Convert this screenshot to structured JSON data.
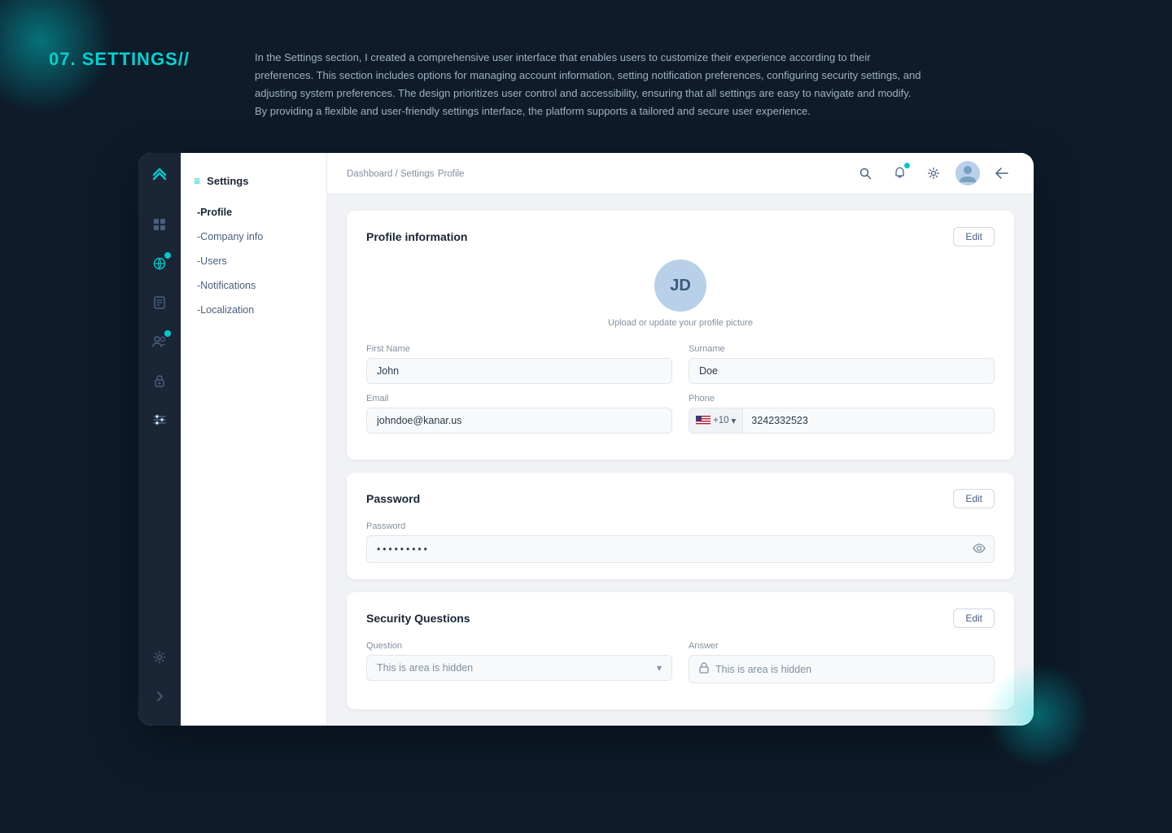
{
  "page": {
    "section_number": "07.",
    "section_title": "SETTINGS//",
    "description": "In the Settings section, I created a comprehensive user interface that enables users to customize their experience according to their preferences. This section includes options for managing account information, setting notification preferences, configuring security settings, and adjusting system preferences. The design prioritizes user control and accessibility, ensuring that all settings are easy to navigate and modify. By providing a flexible and user-friendly settings interface, the platform supports a tailored and secure user experience."
  },
  "breadcrumb": {
    "path": "Dashboard / Settings",
    "current": "Profile"
  },
  "settings_sidebar": {
    "header": "Settings",
    "items": [
      {
        "label": "-Profile",
        "active": true
      },
      {
        "label": "-Company info",
        "active": false
      },
      {
        "label": "-Users",
        "active": false
      },
      {
        "label": "-Notifications",
        "active": false
      },
      {
        "label": "-Localization",
        "active": false
      }
    ]
  },
  "profile_card": {
    "title": "Profile information",
    "edit_label": "Edit",
    "avatar_initials": "JD",
    "avatar_hint": "Upload or update your profile picture",
    "first_name_label": "First Name",
    "first_name_value": "John",
    "surname_label": "Surname",
    "surname_value": "Doe",
    "email_label": "Email",
    "email_value": "johndoe@kanar.us",
    "phone_label": "Phone",
    "phone_prefix": "+10",
    "phone_value": "3242332523"
  },
  "password_card": {
    "title": "Password",
    "edit_label": "Edit",
    "password_label": "Password",
    "password_dots": "•••••••••"
  },
  "security_card": {
    "title": "Security Questions",
    "edit_label": "Edit",
    "question_label": "Question",
    "question_placeholder": "This is area is hidden",
    "answer_label": "Answer",
    "answer_placeholder": "This is area is hidden"
  },
  "icons": {
    "brand": "❯❯",
    "grid": "⊞",
    "globe": "◉",
    "document": "❏",
    "users": "👥",
    "lock": "🔒",
    "sliders": "≡",
    "search": "🔍",
    "bell": "🔔",
    "gear": "⚙",
    "arrow_back": "↩",
    "menu": "≡",
    "eye": "◉",
    "chevron": "▾",
    "lock_small": "🔒",
    "settings_bottom": "⊙",
    "chevron_right": "❯"
  }
}
